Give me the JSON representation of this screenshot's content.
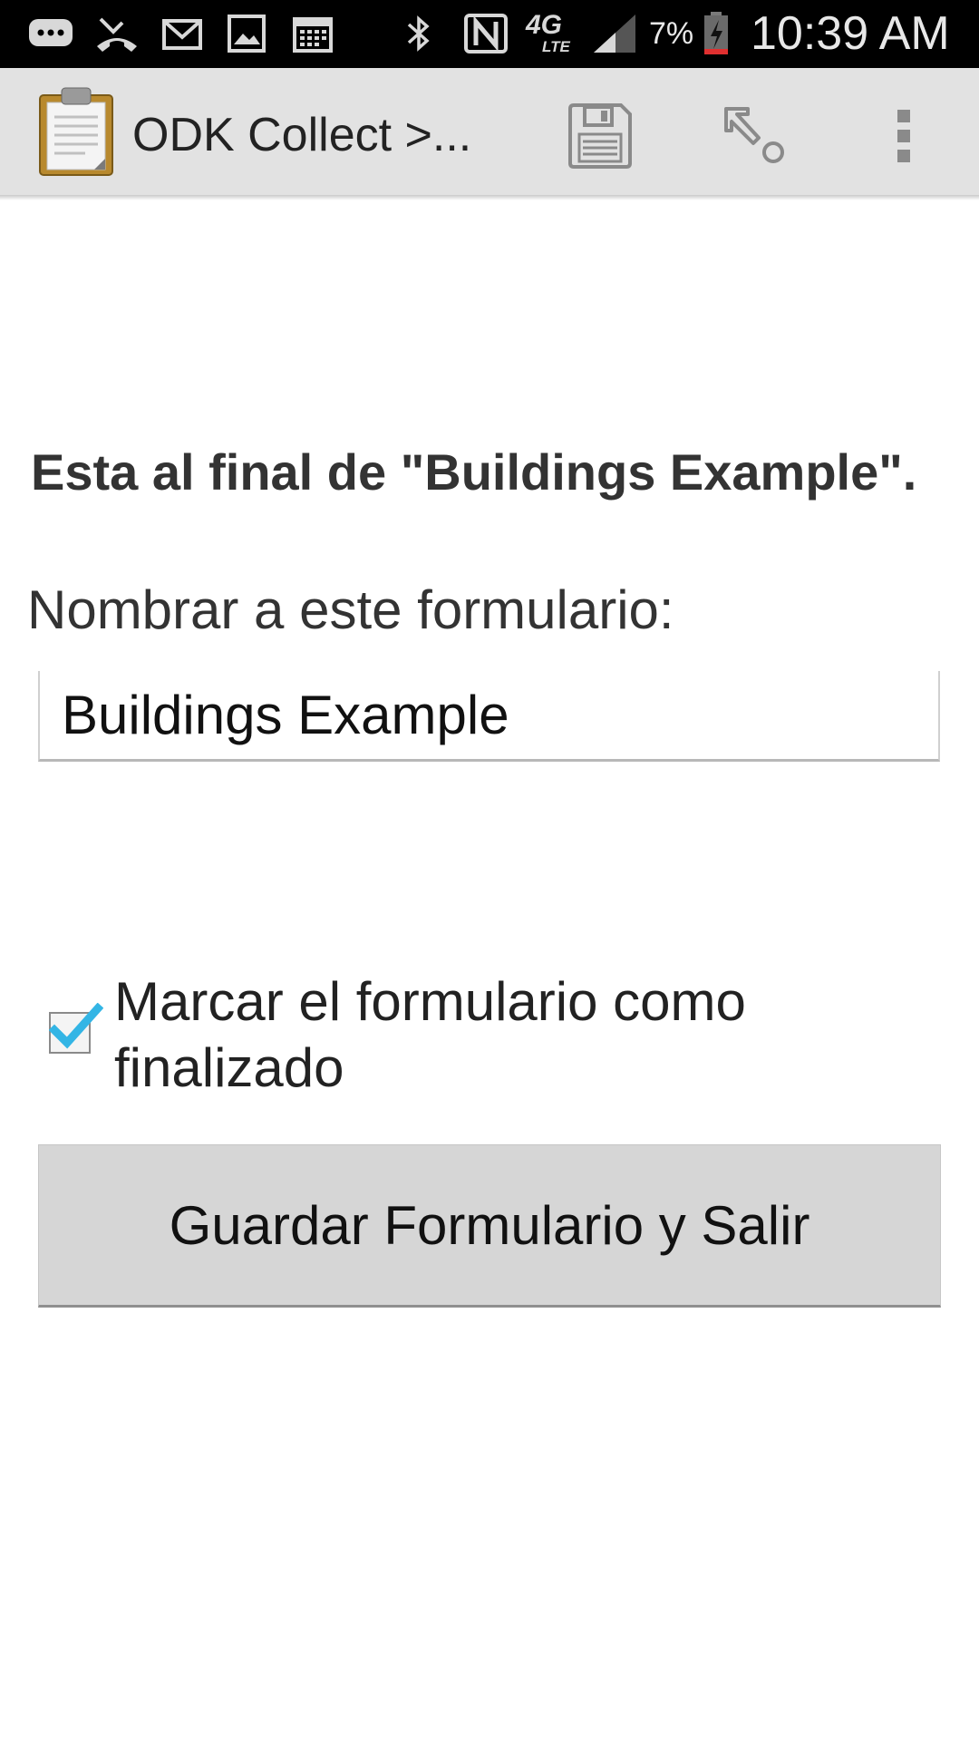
{
  "status_bar": {
    "battery_percent": "7%",
    "time": "10:39 AM",
    "network": "4G",
    "network_sub": "LTE",
    "notification_icons": [
      "message-icon",
      "missed-call-icon",
      "gmail-icon",
      "gallery-icon",
      "calendar-icon"
    ],
    "system_icons": [
      "bluetooth-icon",
      "nfc-icon",
      "network-4g-lte-icon",
      "signal-icon",
      "battery-icon"
    ]
  },
  "action_bar": {
    "title": "ODK Collect >...",
    "app_icon": "clipboard-icon",
    "actions": [
      {
        "name": "save-icon"
      },
      {
        "name": "language-pointer-icon"
      },
      {
        "name": "overflow-menu-icon"
      }
    ]
  },
  "form_end": {
    "heading": "Esta al final de \"Buildings Example\".",
    "name_label": "Nombrar a este formulario:",
    "name_value": "Buildings Example",
    "finalize_label": "Marcar el formulario como finalizado",
    "finalize_checked": true,
    "save_button_label": "Guardar Formulario y Salir"
  },
  "colors": {
    "checkbox_accent": "#33b5e5",
    "action_bar_bg": "#e2e2e2",
    "button_bg": "#d6d6d6"
  }
}
